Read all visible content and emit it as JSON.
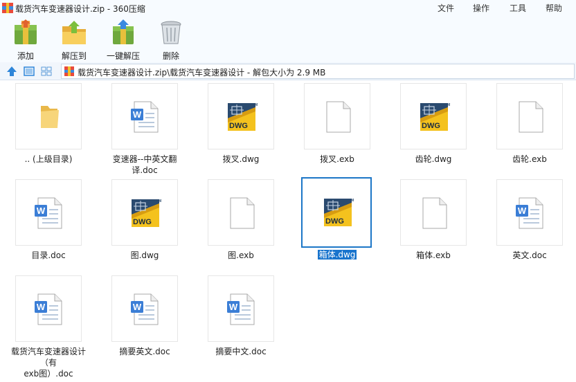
{
  "window": {
    "title": "载货汽车变速器设计.zip - 360压缩",
    "menu": [
      "文件",
      "操作",
      "工具",
      "帮助"
    ]
  },
  "toolbar": {
    "add_label": "添加",
    "extract_label": "解压到",
    "one_click_label": "一键解压",
    "delete_label": "删除"
  },
  "address": {
    "path": "载货汽车变速器设计.zip\\载货汽车变速器设计 - 解包大小为 2.9 MB"
  },
  "files": [
    {
      "name": ".. (上级目录)",
      "icon": "folder-icon"
    },
    {
      "name": "变速器--中英文翻译.doc",
      "icon": "word-doc-icon"
    },
    {
      "name": "拨叉.dwg",
      "icon": "dwg-file-icon"
    },
    {
      "name": "拨叉.exb",
      "icon": "blank-file-icon"
    },
    {
      "name": "齿轮.dwg",
      "icon": "dwg-file-icon"
    },
    {
      "name": "齿轮.exb",
      "icon": "blank-file-icon"
    },
    {
      "name": "目录.doc",
      "icon": "word-doc-icon"
    },
    {
      "name": "图.dwg",
      "icon": "dwg-file-icon"
    },
    {
      "name": "图.exb",
      "icon": "blank-file-icon"
    },
    {
      "name": "箱体.dwg",
      "icon": "dwg-file-icon",
      "selected": true
    },
    {
      "name": "箱体.exb",
      "icon": "blank-file-icon"
    },
    {
      "name": "英文.doc",
      "icon": "word-doc-icon"
    },
    {
      "name": "载货汽车变速器设计（有exb图）.doc",
      "line1": "载货汽车变速器设计（有",
      "line2": "exb图）.doc",
      "icon": "word-doc-icon"
    },
    {
      "name": "摘要英文.doc",
      "icon": "word-doc-icon"
    },
    {
      "name": "摘要中文.doc",
      "icon": "word-doc-icon"
    }
  ],
  "colors": {
    "selection": "#1874cd",
    "dwg_dark": "#2a4a6f",
    "dwg_yellow": "#f4c21e",
    "word_blue": "#3b7ed6"
  }
}
